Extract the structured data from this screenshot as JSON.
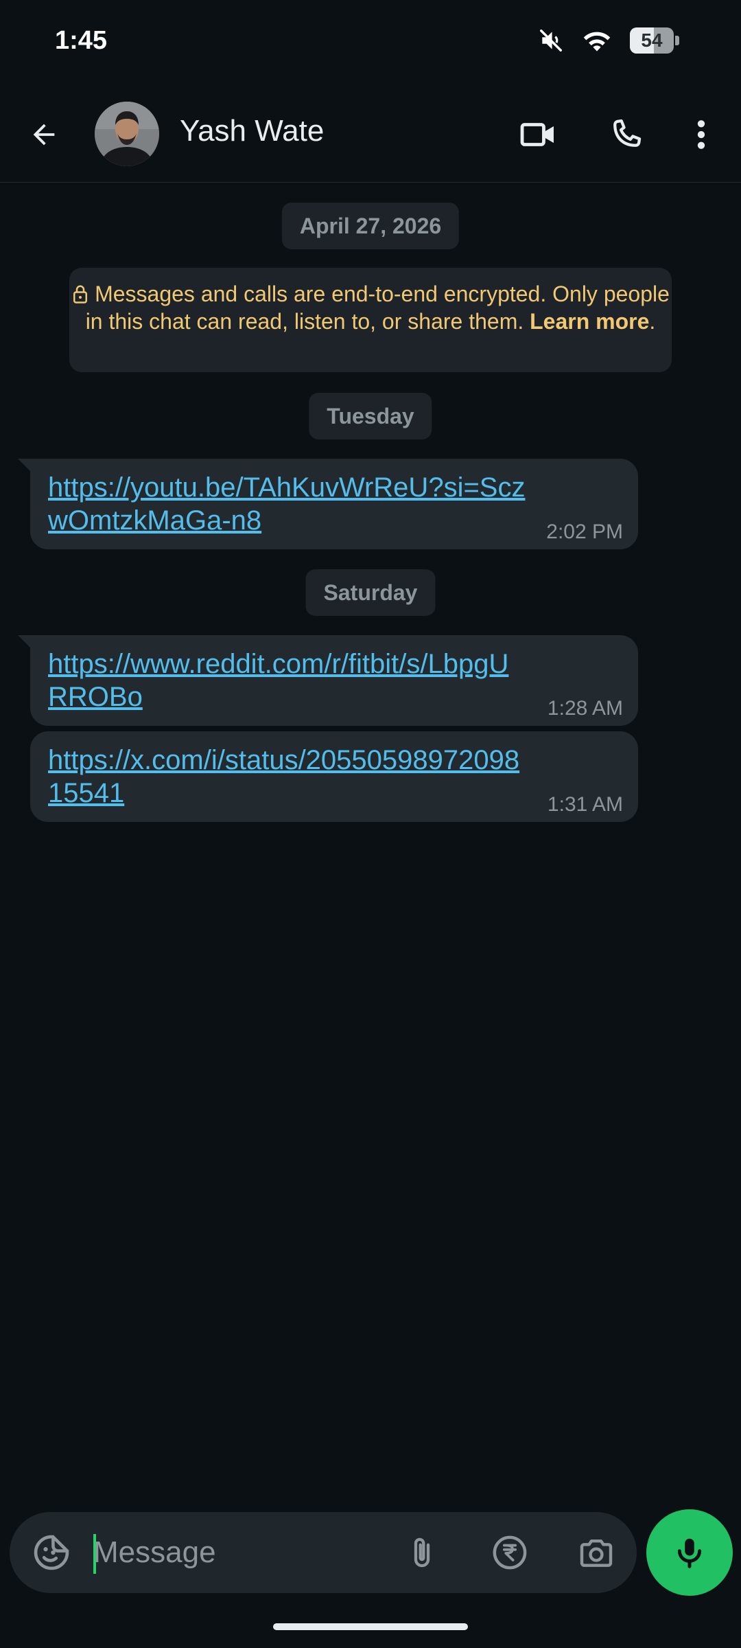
{
  "status_bar": {
    "time": "1:45",
    "battery_percent": "54",
    "battery_level": 0.54,
    "icons": [
      "mute-icon",
      "wifi-icon",
      "battery-icon"
    ]
  },
  "header": {
    "contact_name": "Yash Wate",
    "icons": [
      "back-arrow-icon",
      "video-call-icon",
      "phone-icon",
      "more-vert-icon"
    ]
  },
  "chat": {
    "date_first": "April 27, 2026",
    "encryption_notice": {
      "text": "Messages and calls are end-to-end encrypted. Only people in this chat can read, listen to, or share them.",
      "learn_more": "Learn more",
      "period": "."
    },
    "day_1": "Tuesday",
    "day_2": "Saturday",
    "messages": [
      {
        "text": "https://youtu.be/TAhKuvWrReU?si=SczwOmtzkMaGa-n8",
        "time": "2:02 PM"
      },
      {
        "text": "https://www.reddit.com/r/fitbit/s/LbpgURROBo",
        "time": "1:28 AM"
      },
      {
        "text": "https://x.com/i/status/2055059897209815541",
        "time": "1:31 AM"
      }
    ]
  },
  "composer": {
    "placeholder": "Message",
    "icons": [
      "sticker-icon",
      "attach-icon",
      "rupee-payment-icon",
      "camera-icon",
      "mic-icon"
    ]
  },
  "colors": {
    "background": "#0b1014",
    "bubble": "#232a2f",
    "link": "#53bdeb",
    "encryption_text": "#f2c972",
    "accent": "#21c063"
  }
}
